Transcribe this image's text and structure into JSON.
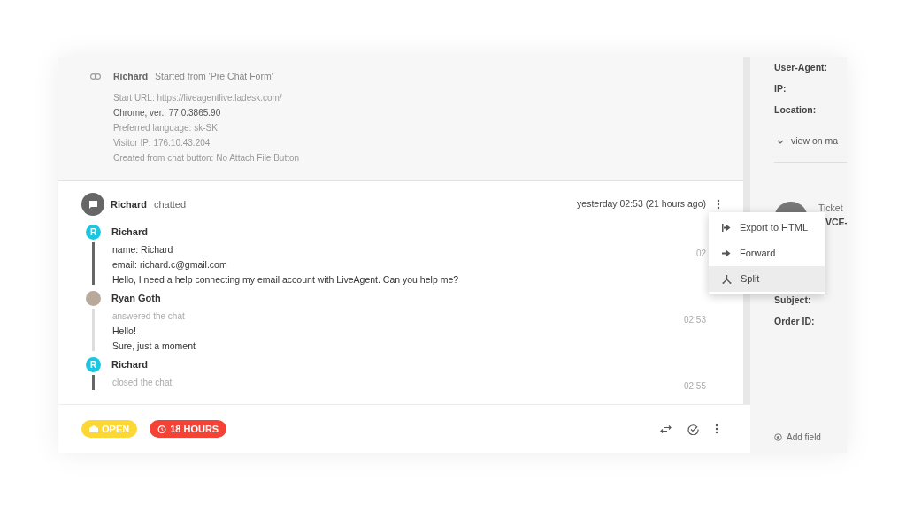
{
  "start_event": {
    "name": "Richard",
    "action": "Started from 'Pre Chat Form'",
    "details": [
      {
        "text": "Start URL: https://liveagentlive.ladesk.com/",
        "emphasis": false
      },
      {
        "text": "Chrome, ver.: 77.0.3865.90",
        "emphasis": true
      },
      {
        "text": "Preferred language: sk-SK",
        "emphasis": false
      },
      {
        "text": "Visitor IP: 176.10.43.204",
        "emphasis": false
      },
      {
        "text": "Created from chat button: No Attach File Button",
        "emphasis": false
      }
    ]
  },
  "chat": {
    "name": "Richard",
    "action": "chatted",
    "time": "yesterday 02:53 (21 hours ago)",
    "messages": [
      {
        "author": "Richard",
        "avatar": "R",
        "kind": "visitor",
        "time": "02",
        "lines": [
          "name: Richard",
          "email: richard.c@gmail.com",
          "Hello, I need a help connecting my email account with LiveAgent. Can you help me?"
        ]
      },
      {
        "author": "Ryan Goth",
        "kind": "agent",
        "note": "answered the chat",
        "time": "02:53",
        "lines": [
          "Hello!",
          "Sure, just a moment"
        ]
      },
      {
        "author": "Richard",
        "avatar": "R",
        "kind": "visitor",
        "note": "closed the chat",
        "time": "02:55"
      }
    ]
  },
  "menu": [
    {
      "label": "Export to HTML",
      "kind": "export",
      "selected": false
    },
    {
      "label": "Forward",
      "kind": "forward",
      "selected": false
    },
    {
      "label": "Split",
      "kind": "split",
      "selected": true
    }
  ],
  "footer": {
    "status": "OPEN",
    "timer": "18 HOURS"
  },
  "sidebar": {
    "labels": [
      "User-Agent:",
      "IP:",
      "Location:"
    ],
    "map_link": "view on ma",
    "ticket_label": "Ticket",
    "ticket_code": "VCE-",
    "fields": [
      "Subject:",
      "Order ID:"
    ],
    "add_field": "Add field"
  }
}
